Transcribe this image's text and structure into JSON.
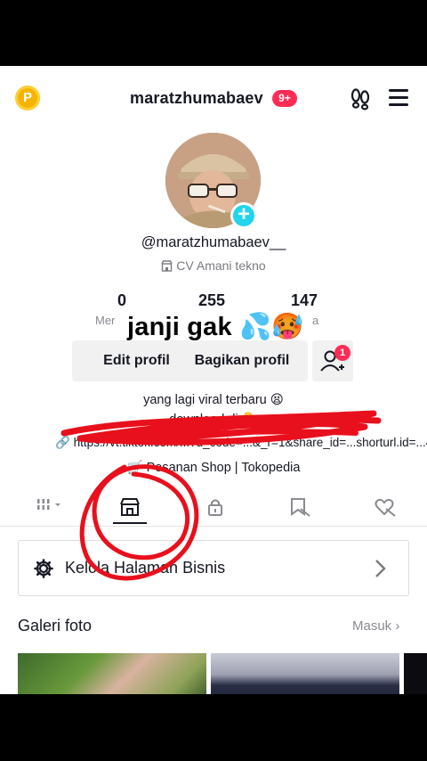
{
  "header": {
    "coin_label": "P",
    "username": "maratzhumabaev",
    "notification_badge": "9+",
    "footprint_icon": "footprint-icon",
    "menu_icon": "hamburger-menu-icon"
  },
  "profile": {
    "handle": "@maratzhumabaev__",
    "company": "CV Amani tekno",
    "overlay_caption": "janji gak 💦🥵"
  },
  "stats": [
    {
      "value": "0",
      "label": "Mer"
    },
    {
      "value": "255",
      "label": ""
    },
    {
      "value": "147",
      "label": "a"
    }
  ],
  "buttons": {
    "edit": "Edit profil",
    "share": "Bagikan profil",
    "add_friend_badge": "1"
  },
  "bio": {
    "line1": "yang lagi viral terbaru 😫",
    "line2": "download di 👇",
    "link": "https://vt.tiktok.com/...?u_code=...&_r=1&share_id=...shorturl.id=...4KS",
    "shop": "🛒 Pesanan Shop | Tokopedia"
  },
  "tabs": [
    {
      "name": "videos",
      "icon": "grid-icon"
    },
    {
      "name": "shop",
      "icon": "storefront-icon",
      "active": true
    },
    {
      "name": "private",
      "icon": "lock-icon"
    },
    {
      "name": "saved",
      "icon": "bookmark-icon"
    },
    {
      "name": "liked",
      "icon": "heart-icon"
    }
  ],
  "business": {
    "label": "Kelola Halaman Bisnis"
  },
  "gallery": {
    "title": "Galeri foto",
    "more": "Masuk"
  },
  "colors": {
    "accent_red": "#fe2c55",
    "accent_cyan": "#20d5ec",
    "scribble": "#e8101c",
    "coin": "#f6b400"
  }
}
